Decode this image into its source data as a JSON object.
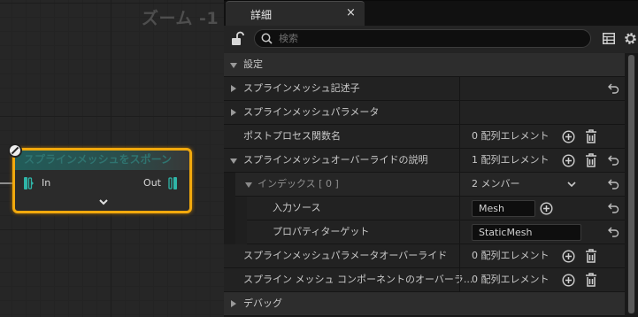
{
  "graph": {
    "zoom_label": "ズーム -1",
    "node": {
      "title": "スプラインメッシュをスポーン",
      "pin_in": "In",
      "pin_out": "Out"
    }
  },
  "details": {
    "tab_title": "詳細",
    "tab_close": "×",
    "search_placeholder": "検索",
    "category_settings": "設定",
    "rows": {
      "spline_mesh_descriptor": "スプラインメッシュ記述子",
      "spline_mesh_params": "スプラインメッシュパラメータ",
      "post_process_func": "ポストプロセス関数名",
      "post_process_value": "0 配列エレメント",
      "override_desc": "スプラインメッシュオーバーライドの説明",
      "override_desc_value": "1 配列エレメント",
      "index_label": "インデックス [ 0 ]",
      "index_value": "2 メンバー",
      "input_source": "入力ソース",
      "input_source_value": "Mesh",
      "property_target": "プロパティターゲット",
      "property_target_value": "StaticMesh",
      "params_override": "スプラインメッシュパラメータオーバーライド",
      "params_override_value": "0 配列エレメント",
      "component_override": "スプライン メッシュ コンポーネントのオーバーラ...",
      "component_override_value": "0 配列エレメント",
      "debug": "デバッグ"
    }
  },
  "colors": {
    "node_border": "#f2a90d",
    "node_header": "#225c59",
    "pin": "#2fb5a8"
  }
}
